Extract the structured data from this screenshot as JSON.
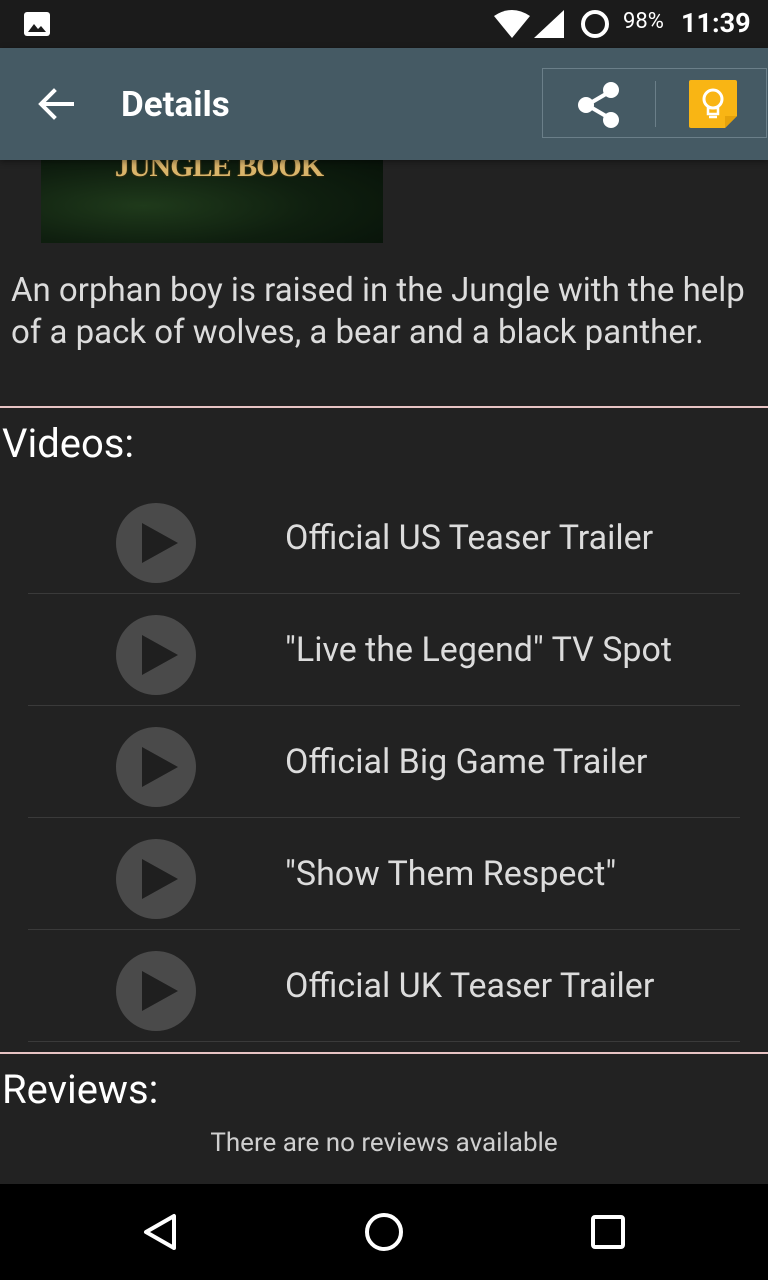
{
  "status_bar": {
    "battery": "98%",
    "time": "11:39",
    "icons": [
      "image-icon",
      "wifi-icon",
      "signal-icon",
      "battery-ring-icon"
    ]
  },
  "app_bar": {
    "title": "Details",
    "icons": [
      "back-arrow-icon",
      "share-icon",
      "lightbulb-icon"
    ],
    "accent_color": "#455a64",
    "idea_color": "#f9b514"
  },
  "movie": {
    "poster_title": "JUNGLE BOOK",
    "overview": "An orphan boy is raised in the Jungle with the help of a pack of wolves, a bear and a black panther."
  },
  "videos": {
    "heading": "Videos:",
    "items": [
      {
        "name": "Official US Teaser Trailer"
      },
      {
        "name": "\"Live the Legend\" TV Spot"
      },
      {
        "name": "Official Big Game Trailer"
      },
      {
        "name": "\"Show Them Respect\""
      },
      {
        "name": "Official UK Teaser Trailer"
      }
    ]
  },
  "reviews": {
    "heading": "Reviews:",
    "empty_text": "There are no reviews available"
  },
  "nav_bar": {
    "icons": [
      "nav-back-icon",
      "nav-home-icon",
      "nav-recents-icon"
    ]
  }
}
